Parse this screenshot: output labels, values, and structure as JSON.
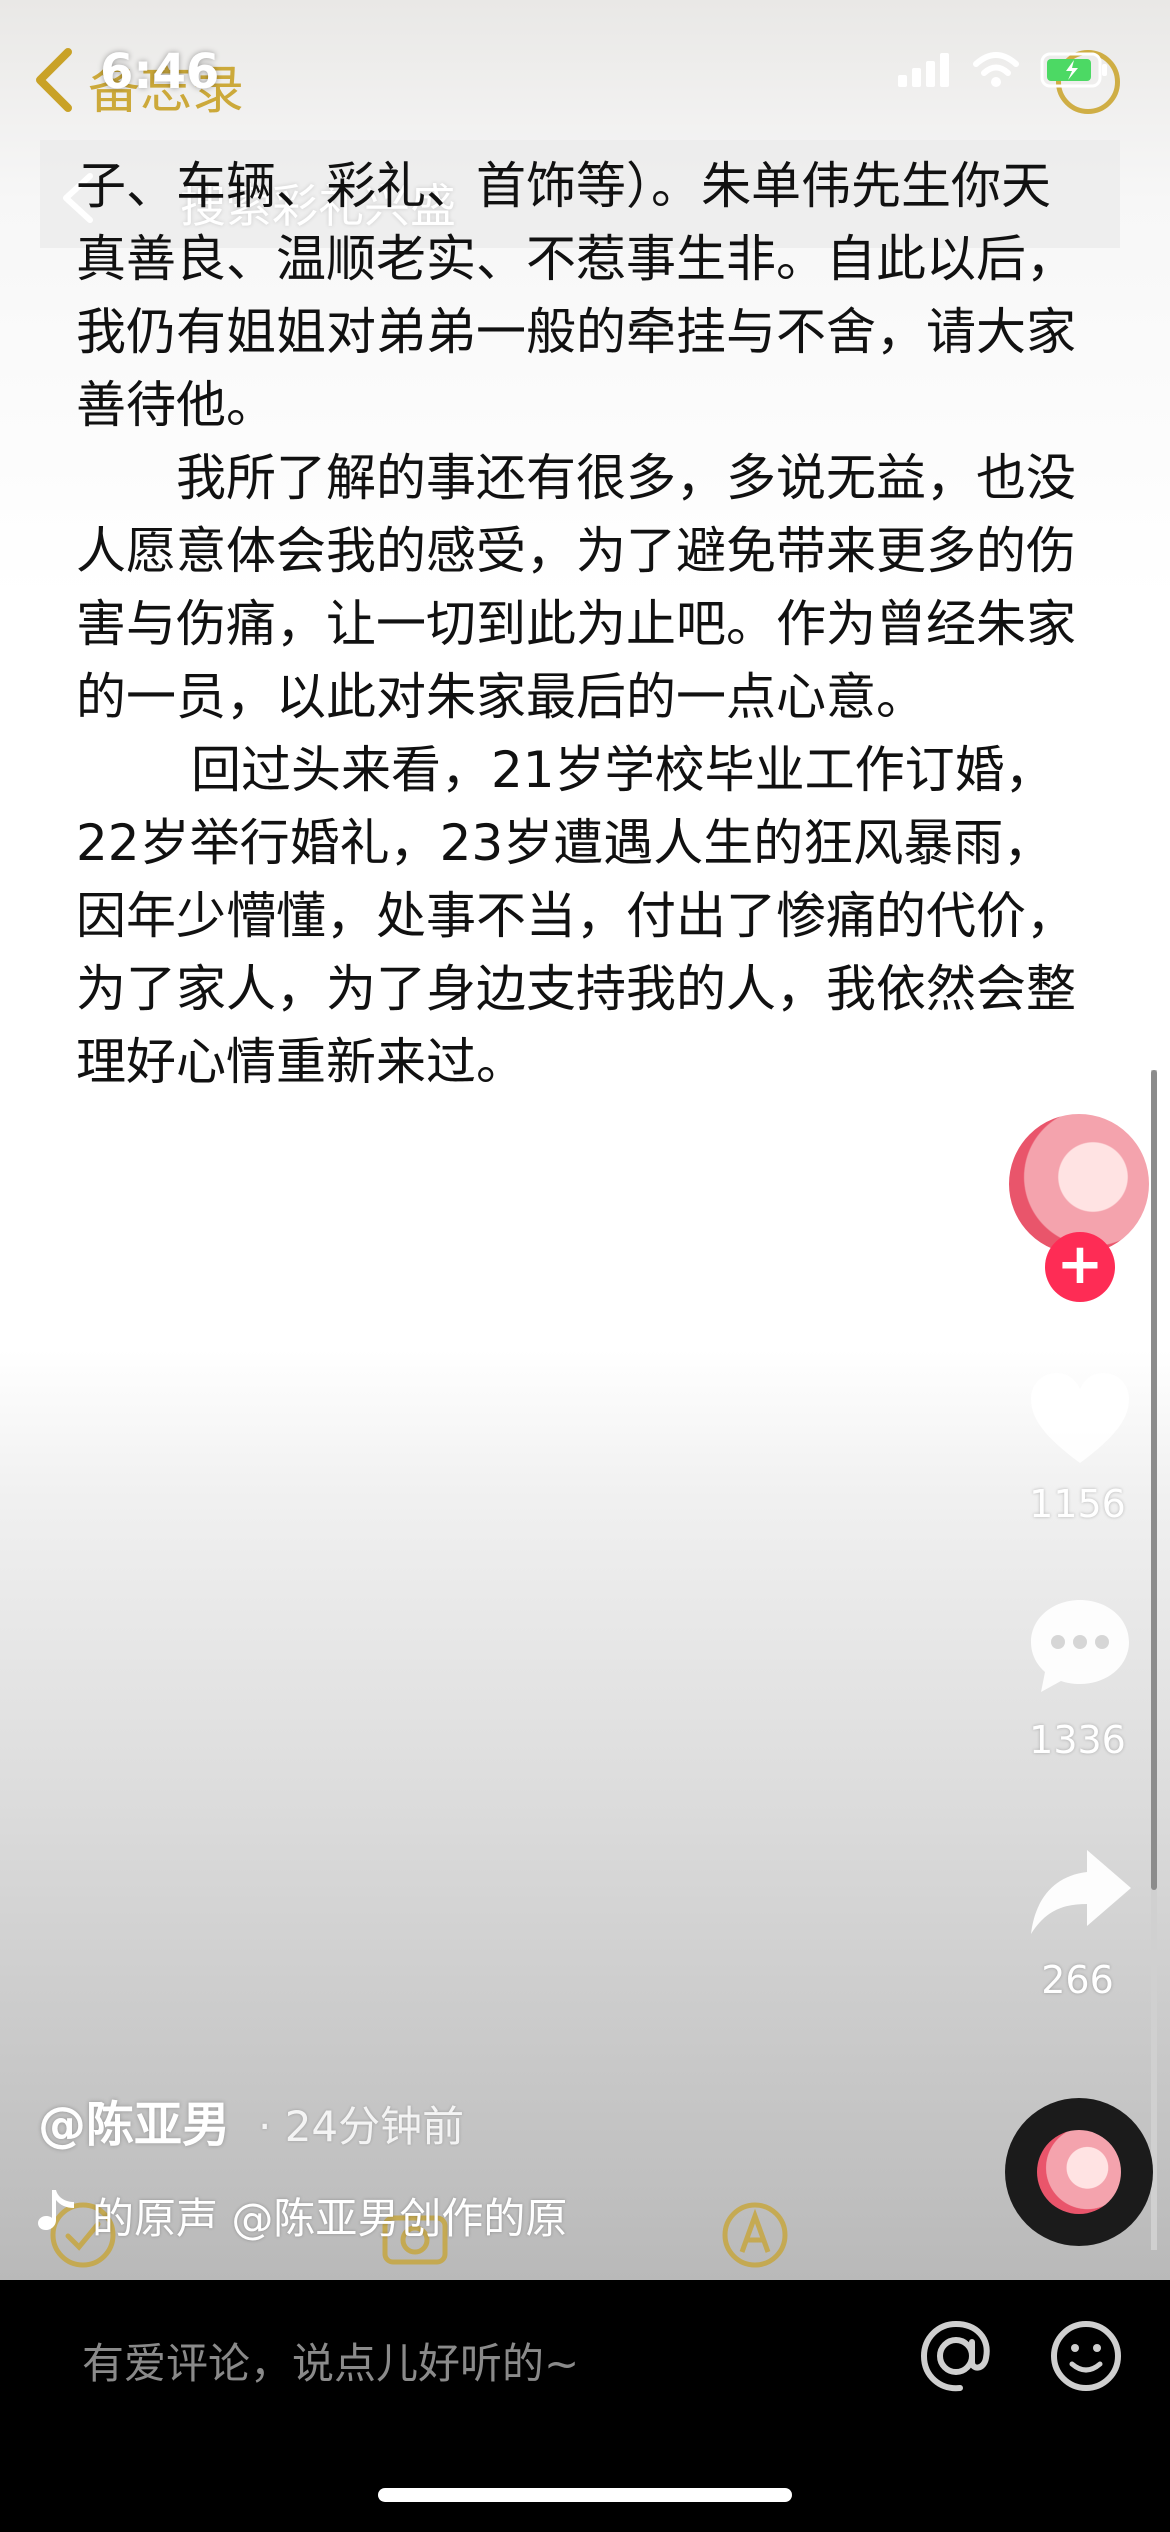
{
  "status_bar": {
    "time": "6:46"
  },
  "memo_app": {
    "title": "备忘录",
    "search_hint": "搜索彩礼兴盛"
  },
  "memo": {
    "paragraphs": [
      "子、车辆、彩礼、首饰等）。朱单伟先生你天真善良、温顺老实、不惹事生非。自此以后，我仍有姐姐对弟弟一般的牵挂与不舍，请大家善待他。",
      "我所了解的事还有很多，多说无益，也没人愿意体会我的感受，为了避免带来更多的伤害与伤痛，让一切到此为止吧。作为曾经朱家的一员，以此对朱家最后的一点心意。",
      "回过头来看，21岁学校毕业工作订婚，22岁举行婚礼，23岁遭遇人生的狂风暴雨，因年少懵懂，处事不当，付出了惨痛的代价，为了家人，为了身边支持我的人，我依然会整理好心情重新来过。"
    ]
  },
  "rail": {
    "follow_label": "+",
    "like_count": "1156",
    "comment_count": "1336",
    "share_count": "266"
  },
  "video_info": {
    "author": "@陈亚男",
    "time_ago": "· 24分钟前",
    "music": "的原声    @陈亚男创作的原"
  },
  "comment_bar": {
    "placeholder": "有爱评论，说点儿好听的~"
  },
  "icons": [
    "back-icon",
    "signal-icon",
    "wifi-icon",
    "battery-icon",
    "heart-icon",
    "comment-icon",
    "share-icon",
    "music-note-icon",
    "at-icon",
    "emoji-icon",
    "checklist-icon",
    "camera-icon",
    "pen-icon"
  ],
  "colors": {
    "accent": "#fe2c55",
    "memo_gold": "#c9a227"
  }
}
